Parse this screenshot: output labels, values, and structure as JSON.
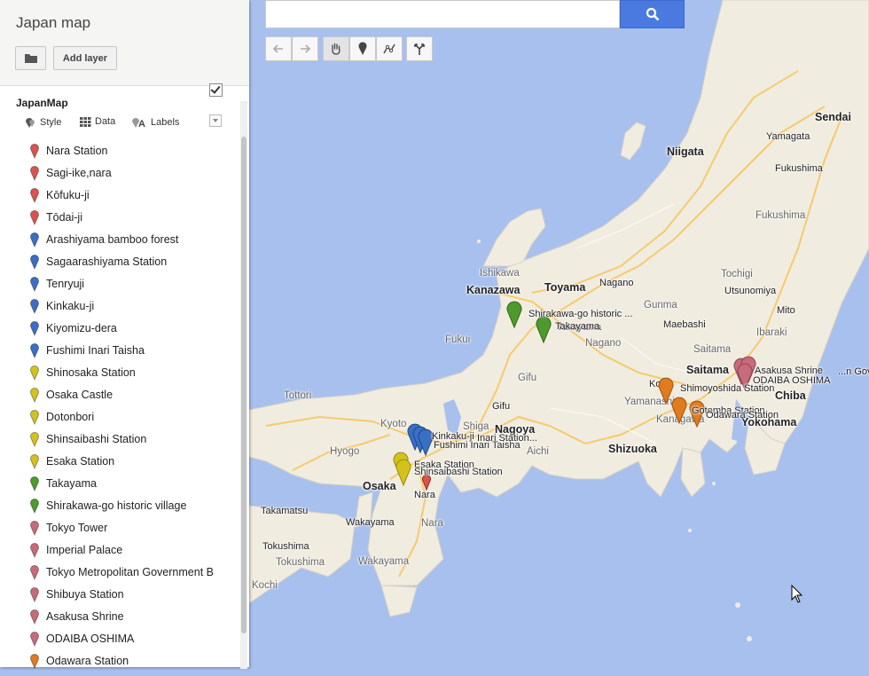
{
  "panel": {
    "title": "Japan map",
    "add_layer_label": "Add layer",
    "layer": {
      "name": "JapanMap",
      "checked": true,
      "style_label": "Style",
      "data_label": "Data",
      "labels_label": "Labels"
    },
    "items": [
      {
        "label": "Nara Station",
        "color": "#d9534f"
      },
      {
        "label": "Sagi-ike,nara",
        "color": "#d9534f"
      },
      {
        "label": "Kōfuku-ji",
        "color": "#d9534f"
      },
      {
        "label": "Tōdai-ji",
        "color": "#d9534f"
      },
      {
        "label": "Arashiyama bamboo forest",
        "color": "#3b6fc4"
      },
      {
        "label": "Sagaarashiyama Station",
        "color": "#3b6fc4"
      },
      {
        "label": "Tenryuji",
        "color": "#3b6fc4"
      },
      {
        "label": "Kinkaku-ji",
        "color": "#3b6fc4"
      },
      {
        "label": "Kiyomizu-dera",
        "color": "#3b6fc4"
      },
      {
        "label": "Fushimi Inari Taisha",
        "color": "#3b6fc4"
      },
      {
        "label": "Shinosaka Station",
        "color": "#d4c21c"
      },
      {
        "label": "Osaka Castle",
        "color": "#d4c21c"
      },
      {
        "label": "Dotonbori",
        "color": "#d4c21c"
      },
      {
        "label": "Shinsaibashi Station",
        "color": "#d4c21c"
      },
      {
        "label": "Esaka Station",
        "color": "#d4c21c"
      },
      {
        "label": "Takayama",
        "color": "#4e9a2d"
      },
      {
        "label": "Shirakawa-go historic village",
        "color": "#4e9a2d"
      },
      {
        "label": "Tokyo Tower",
        "color": "#c76b7a"
      },
      {
        "label": "Imperial Palace",
        "color": "#c76b7a"
      },
      {
        "label": "Tokyo Metropolitan Government B",
        "color": "#c76b7a"
      },
      {
        "label": "Shibuya Station",
        "color": "#c76b7a"
      },
      {
        "label": "Asakusa Shrine",
        "color": "#c76b7a"
      },
      {
        "label": "ODAIBA OSHIMA",
        "color": "#c76b7a"
      },
      {
        "label": "Odawara Station",
        "color": "#e07b1f"
      }
    ]
  },
  "map": {
    "labels": {
      "sendai": "Sendai",
      "niigata": "Niigata",
      "yamagata": "Yamagata",
      "fukushima_city": "Fukushima",
      "fukushima_pref": "Fukushima",
      "ishikawa": "Ishikawa",
      "kanazawa": "Kanazawa",
      "toyama": "Toyama",
      "nagano_city": "Nagano",
      "gunma": "Gunma",
      "tochigi": "Tochigi",
      "utsunomiya": "Utsunomiya",
      "mito": "Mito",
      "maebashi": "Maebashi",
      "fukui": "Fukui",
      "takayama": "Takayama",
      "nagano_pref": "Nagano",
      "saitama_pref": "Saitama",
      "ibaraki": "Ibaraki",
      "saitama": "Saitama",
      "gifu_pref": "Gifu",
      "tottori": "Tottori",
      "gifu": "Gifu",
      "kyoto": "Kyoto",
      "shiga": "Shiga",
      "nagoya": "Nagoya",
      "hyogo": "Hyogo",
      "aichi": "Aichi",
      "shizuoka": "Shizuoka",
      "osaka": "Osaka",
      "nara": "Nara",
      "nara_pref": "Nara",
      "takamatsu": "Takamatsu",
      "wakayama_city": "Wakayama",
      "tokushima_city": "Tokushima",
      "tokushima": "Tokushima",
      "wakayama_pref": "Wakayama",
      "kochi": "Kochi",
      "kofu": "Kofu",
      "yamanashi": "Yamanashi",
      "kanagawa": "Kanagawa",
      "chiba": "Chiba",
      "yokohama": "Yokohama"
    },
    "marker_labels": {
      "shirakawa": "Shirakawa-go historic ...",
      "takayama": "Takayama",
      "asakusa": "Asakusa Shrine",
      "tokyo_gov": "...n Gov.",
      "odaiba": "ODAIBA OSHIMA",
      "shimoyoshida": "Shimoyoshida Station",
      "gotemba": "Gotemba Station",
      "odawara": "Odawara Station",
      "kinkaku": "Kinkaku-ji",
      "fushimi": "Fushimi Inari Taisha",
      "inari": "Inari Station...",
      "esaka": "Esaka Station",
      "shinsaibashi": "Shinsaibashi Station"
    }
  },
  "colors": {
    "water": "#a8c0ee",
    "land": "#f1ece0",
    "search_btn": "#4a7ae0"
  },
  "icons": {
    "folder": "folder-icon",
    "search": "search-icon",
    "undo": "undo-icon",
    "redo": "redo-icon",
    "hand": "hand-icon",
    "marker": "marker-icon",
    "draw_line": "draw-line-icon",
    "directions": "directions-icon"
  }
}
